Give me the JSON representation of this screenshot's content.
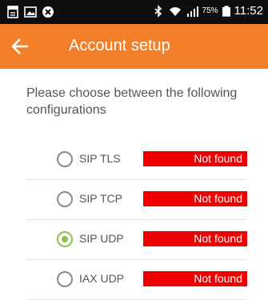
{
  "status_bar": {
    "battery_percent": "75%",
    "time": "11:52",
    "icons": [
      "document-icon",
      "image-icon",
      "close-circle-icon",
      "bluetooth-icon",
      "wifi-icon",
      "signal-icon",
      "battery-icon"
    ]
  },
  "app_bar": {
    "back_icon": "arrow-left-icon",
    "title": "Account setup",
    "color": "#f37f2a"
  },
  "intro_text": "Please choose between the following configurations",
  "configurations": [
    {
      "label": "SIP TLS",
      "selected": false,
      "status": "Not found"
    },
    {
      "label": "SIP TCP",
      "selected": false,
      "status": "Not found"
    },
    {
      "label": "SIP UDP",
      "selected": true,
      "status": "Not found"
    },
    {
      "label": "IAX UDP",
      "selected": false,
      "status": "Not found"
    }
  ],
  "colors": {
    "status_bg": "#ee0000",
    "selected": "#8bc34a"
  }
}
